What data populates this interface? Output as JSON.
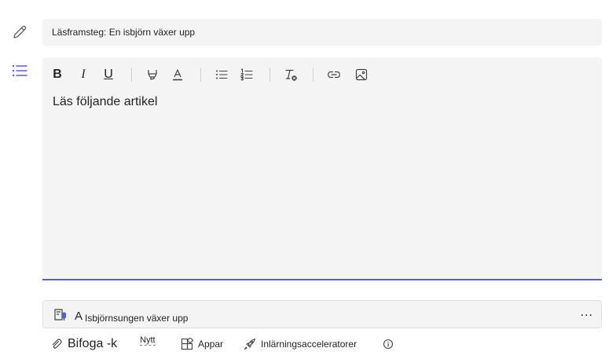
{
  "assignment": {
    "title_value": "Läsframsteg: En isbjörn växer upp"
  },
  "editor": {
    "toolbar": {
      "bold_label": "B",
      "italic_label": "I",
      "underline_label": "U"
    },
    "body_text": "Läs följande artikel"
  },
  "resource": {
    "prefix": "A",
    "name": "Isbjörnsungen växer upp",
    "more_label": "..."
  },
  "actions": {
    "attach_label": "Bifoga -k",
    "new_label": "Nytt",
    "apps_label": "Appar",
    "accelerators_label": "Inlärningsacceleratorer"
  },
  "colors": {
    "accent": "#5b5fc7",
    "field_background": "#f4f4f4"
  }
}
